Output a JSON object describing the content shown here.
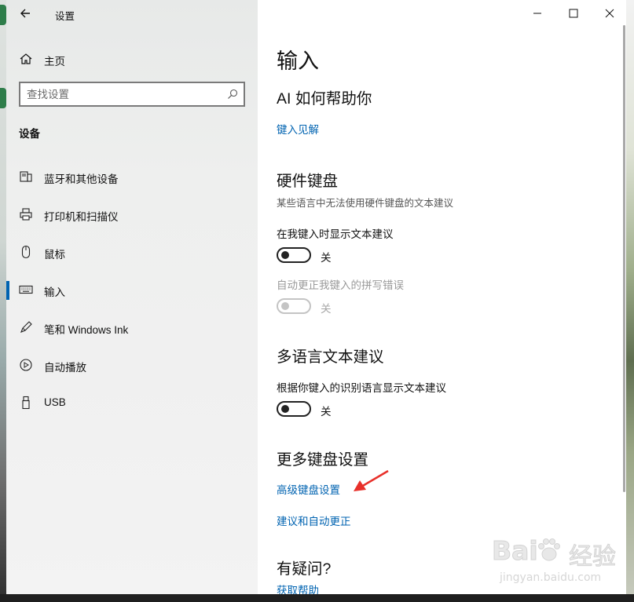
{
  "window": {
    "title": "设置",
    "accent_color": "#0063b1",
    "link_color": "#0063b1"
  },
  "sidebar": {
    "home_label": "主页",
    "search_placeholder": "查找设置",
    "section_label": "设备",
    "items": [
      {
        "label": "蓝牙和其他设备",
        "icon": "bluetooth-devices-icon",
        "active": false
      },
      {
        "label": "打印机和扫描仪",
        "icon": "printer-icon",
        "active": false
      },
      {
        "label": "鼠标",
        "icon": "mouse-icon",
        "active": false
      },
      {
        "label": "输入",
        "icon": "keyboard-icon",
        "active": true
      },
      {
        "label": "笔和 Windows Ink",
        "icon": "pen-icon",
        "active": false
      },
      {
        "label": "自动播放",
        "icon": "autoplay-icon",
        "active": false
      },
      {
        "label": "USB",
        "icon": "usb-icon",
        "active": false
      }
    ]
  },
  "main": {
    "page_title": "输入",
    "ai_section": {
      "heading": "AI 如何帮助你",
      "link": "键入见解"
    },
    "hardware_keyboard": {
      "heading": "硬件键盘",
      "description": "某些语言中无法使用硬件键盘的文本建议",
      "option1_label": "在我键入时显示文本建议",
      "option1_state": "关",
      "option2_label": "自动更正我键入的拼写错误",
      "option2_state": "关"
    },
    "multilingual": {
      "heading": "多语言文本建议",
      "option_label": "根据你键入的识别语言显示文本建议",
      "option_state": "关"
    },
    "more_keyboard": {
      "heading": "更多键盘设置",
      "link1": "高级键盘设置",
      "link2": "建议和自动更正"
    },
    "help": {
      "heading": "有疑问?",
      "link": "获取帮助"
    }
  },
  "watermark": {
    "brand": "Bai",
    "text": "经验",
    "url": "jingyan.baidu.com"
  }
}
